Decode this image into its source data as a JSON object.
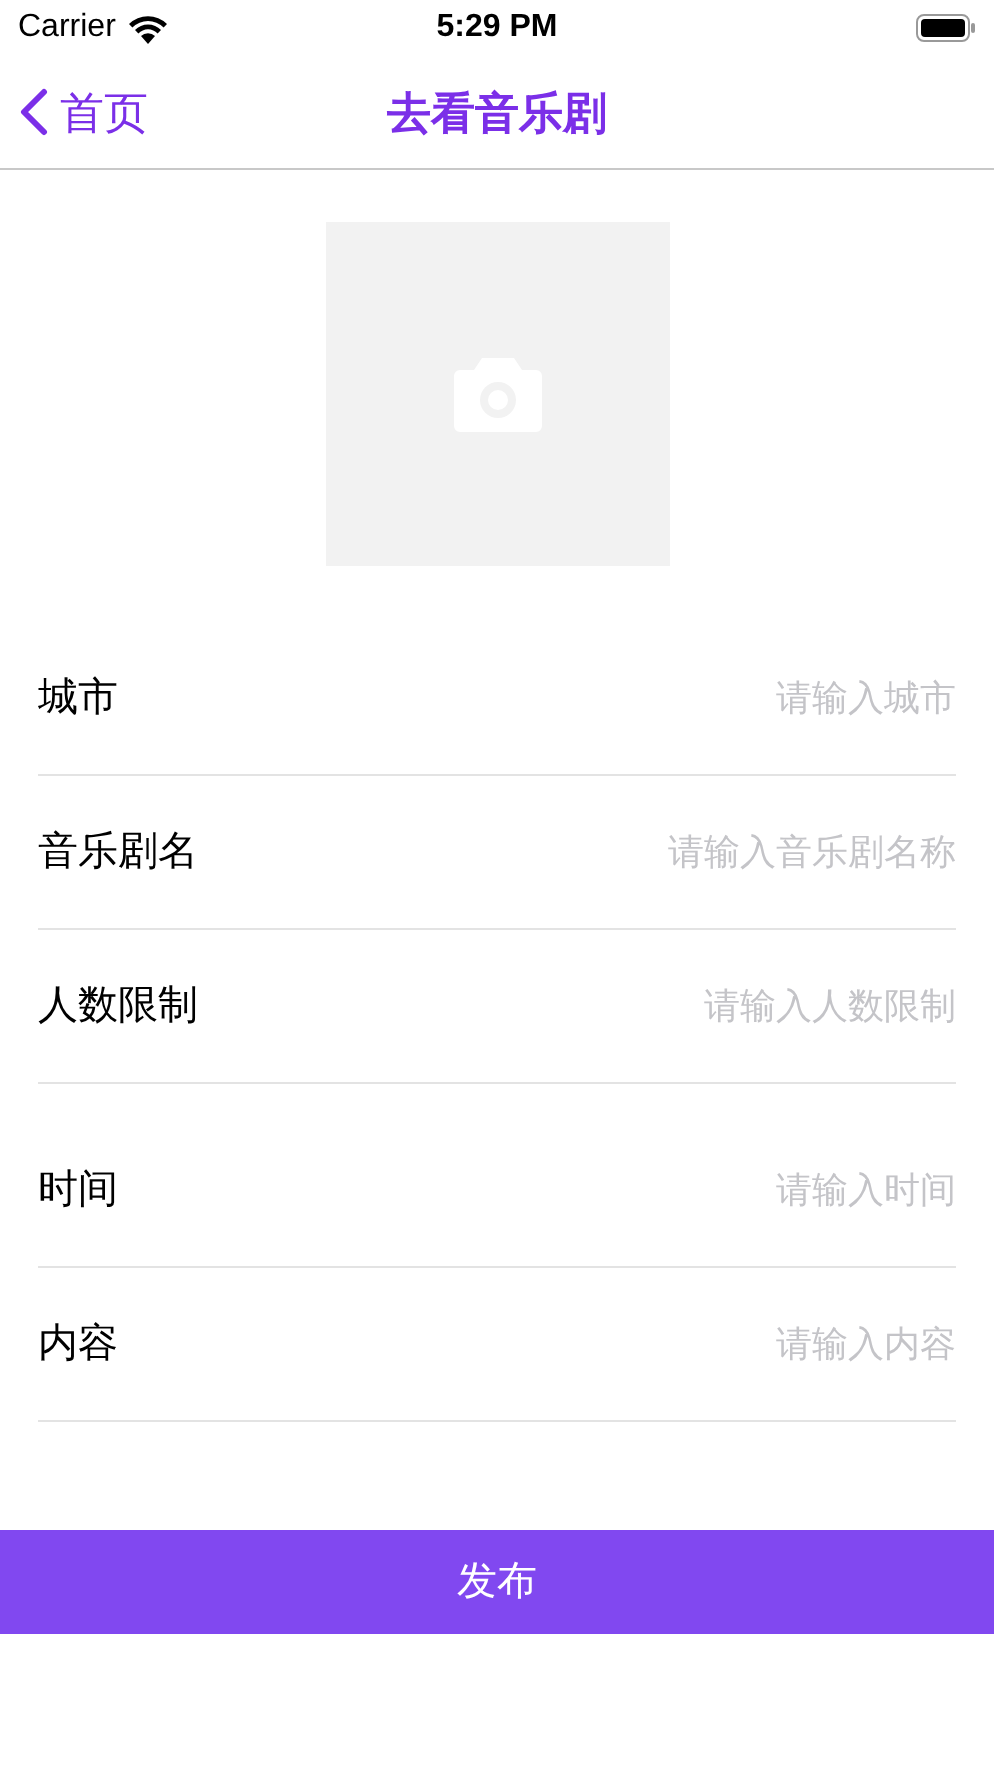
{
  "status_bar": {
    "carrier": "Carrier",
    "time": "5:29 PM"
  },
  "nav": {
    "back": "首页",
    "title": "去看音乐剧"
  },
  "photo": {
    "kind": "picture"
  },
  "field_groups": [
    [
      {
        "label": "城市",
        "placeholder": "请输入城市"
      },
      {
        "label": "音乐剧名",
        "placeholder": "请输入音乐剧名称"
      },
      {
        "label": "人数限制",
        "placeholder": "请输入人数限制"
      }
    ],
    [
      {
        "label": "时间",
        "placeholder": "请输入时间"
      },
      {
        "label": "内容",
        "placeholder": "请输入内容"
      }
    ]
  ],
  "submit": "发布"
}
